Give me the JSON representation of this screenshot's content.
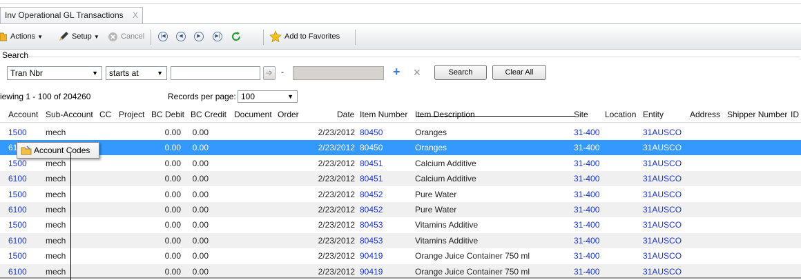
{
  "tab": {
    "title": "Inv Operational GL Transactions",
    "close": "X"
  },
  "toolbar": {
    "actions": "Actions",
    "setup": "Setup",
    "cancel": "Cancel",
    "favorites": "Add to Favorites"
  },
  "search": {
    "label": "Search",
    "field": "Tran Nbr",
    "operator": "starts at",
    "value": "",
    "range_separator": "-",
    "search_button": "Search",
    "clear_button": "Clear All"
  },
  "paging": {
    "viewing": "iewing  1 - 100  of  204260",
    "records_label": "Records per page:",
    "records_value": "100"
  },
  "grid": {
    "columns": [
      "Account",
      "Sub-Account",
      "CC",
      "Project",
      "BC Debit",
      "BC Credit",
      "Document",
      "Order",
      "Date",
      "Item Number",
      "Item Description",
      "Site",
      "Location",
      "Entity",
      "Address",
      "Shipper Number",
      "ID"
    ],
    "rows": [
      {
        "account": "1500",
        "sub": "mech",
        "debit": "0.00",
        "credit": "0.00",
        "date": "2/23/2012",
        "item": "80450",
        "desc": "Oranges",
        "site": "31-400",
        "entity": "31AUSCO"
      },
      {
        "account": "61",
        "sub": "",
        "debit": "0.00",
        "credit": "0.00",
        "date": "2/23/2012",
        "item": "80450",
        "desc": "Oranges",
        "site": "31-400",
        "entity": "31AUSCO"
      },
      {
        "account": "1500",
        "sub": "mech",
        "debit": "0.00",
        "credit": "0.00",
        "date": "2/23/2012",
        "item": "80451",
        "desc": "Calcium Additive",
        "site": "31-400",
        "entity": "31AUSCO"
      },
      {
        "account": "6100",
        "sub": "mech",
        "debit": "0.00",
        "credit": "0.00",
        "date": "2/23/2012",
        "item": "80451",
        "desc": "Calcium Additive",
        "site": "31-400",
        "entity": "31AUSCO"
      },
      {
        "account": "1500",
        "sub": "mech",
        "debit": "0.00",
        "credit": "0.00",
        "date": "2/23/2012",
        "item": "80452",
        "desc": "Pure Water",
        "site": "31-400",
        "entity": "31AUSCO"
      },
      {
        "account": "6100",
        "sub": "mech",
        "debit": "0.00",
        "credit": "0.00",
        "date": "2/23/2012",
        "item": "80452",
        "desc": "Pure Water",
        "site": "31-400",
        "entity": "31AUSCO"
      },
      {
        "account": "1500",
        "sub": "mech",
        "debit": "0.00",
        "credit": "0.00",
        "date": "2/23/2012",
        "item": "80453",
        "desc": "Vitamins Additive",
        "site": "31-400",
        "entity": "31AUSCO"
      },
      {
        "account": "6100",
        "sub": "mech",
        "debit": "0.00",
        "credit": "0.00",
        "date": "2/23/2012",
        "item": "80453",
        "desc": "Vitamins Additive",
        "site": "31-400",
        "entity": "31AUSCO"
      },
      {
        "account": "1500",
        "sub": "mech",
        "debit": "0.00",
        "credit": "0.00",
        "date": "2/23/2012",
        "item": "90419",
        "desc": "Orange Juice Container 750 ml",
        "site": "31-400",
        "entity": "31AUSCO"
      },
      {
        "account": "6100",
        "sub": "mech",
        "debit": "0.00",
        "credit": "0.00",
        "date": "2/23/2012",
        "item": "90419",
        "desc": "Orange Juice Container 750 ml",
        "site": "31-400",
        "entity": "31AUSCO"
      }
    ]
  },
  "popup": {
    "label": "Account Codes"
  },
  "colors": {
    "selection": "#3399ff",
    "link": "#1a34c8",
    "alt_row": "#f0f0f0",
    "accent_plus": "#3a7bd5"
  },
  "icons": [
    "folder-icon",
    "pencil-icon",
    "cancel-icon",
    "first-page-icon",
    "previous-page-icon",
    "next-page-icon",
    "last-page-icon",
    "refresh-icon",
    "star-icon",
    "plus-icon",
    "clear-x-icon",
    "go-arrow-icon"
  ]
}
